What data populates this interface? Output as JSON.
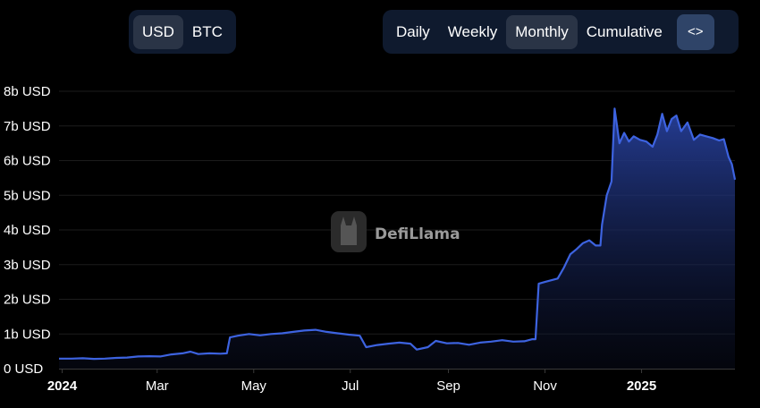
{
  "currency_toggle": {
    "options": [
      "USD",
      "BTC"
    ],
    "selected": "USD"
  },
  "period_toggle": {
    "options": [
      "Daily",
      "Weekly",
      "Monthly",
      "Cumulative"
    ],
    "selected": "Monthly"
  },
  "embed_button": {
    "icon": "code-brackets-icon",
    "glyph": "<>"
  },
  "watermark": {
    "text": "DefiLlama"
  },
  "colors": {
    "line": "#3d63e0",
    "fill_top": "#27409c",
    "background": "#000000",
    "grid": "#1c1c1c",
    "button_bg": "#0f1a2e",
    "active_bg": "#2a3446",
    "embed_bg": "#2f4468"
  },
  "chart_data": {
    "type": "area",
    "title": "",
    "xlabel": "",
    "ylabel": "",
    "ylim": [
      0,
      8
    ],
    "y_unit": "b USD",
    "y_ticks": [
      "0 USD",
      "1b USD",
      "2b USD",
      "3b USD",
      "4b USD",
      "5b USD",
      "6b USD",
      "7b USD",
      "8b USD"
    ],
    "x_ticks": [
      {
        "label": "2024",
        "date": "2024-01-01",
        "bold": true
      },
      {
        "label": "Mar",
        "date": "2024-03-01",
        "bold": false
      },
      {
        "label": "May",
        "date": "2024-05-01",
        "bold": false
      },
      {
        "label": "Jul",
        "date": "2024-07-01",
        "bold": false
      },
      {
        "label": "Sep",
        "date": "2024-09-01",
        "bold": false
      },
      {
        "label": "Nov",
        "date": "2024-11-01",
        "bold": false
      },
      {
        "label": "2025",
        "date": "2025-01-01",
        "bold": true
      }
    ],
    "x_range": [
      "2023-12-30",
      "2025-03-01"
    ],
    "grid": true,
    "series": [
      {
        "values": [
          [
            "2023-12-30",
            0.29
          ],
          [
            "2024-01-07",
            0.29
          ],
          [
            "2024-01-14",
            0.3
          ],
          [
            "2024-01-21",
            0.28
          ],
          [
            "2024-01-28",
            0.29
          ],
          [
            "2024-02-04",
            0.31
          ],
          [
            "2024-02-11",
            0.32
          ],
          [
            "2024-02-18",
            0.35
          ],
          [
            "2024-02-25",
            0.36
          ],
          [
            "2024-03-03",
            0.35
          ],
          [
            "2024-03-10",
            0.41
          ],
          [
            "2024-03-17",
            0.44
          ],
          [
            "2024-03-22",
            0.49
          ],
          [
            "2024-03-27",
            0.42
          ],
          [
            "2024-04-03",
            0.44
          ],
          [
            "2024-04-10",
            0.43
          ],
          [
            "2024-04-14",
            0.44
          ],
          [
            "2024-04-16",
            0.9
          ],
          [
            "2024-04-21",
            0.95
          ],
          [
            "2024-04-28",
            1.0
          ],
          [
            "2024-05-05",
            0.96
          ],
          [
            "2024-05-12",
            1.0
          ],
          [
            "2024-05-19",
            1.02
          ],
          [
            "2024-05-26",
            1.06
          ],
          [
            "2024-06-02",
            1.1
          ],
          [
            "2024-06-09",
            1.12
          ],
          [
            "2024-06-16",
            1.06
          ],
          [
            "2024-06-23",
            1.02
          ],
          [
            "2024-06-30",
            0.98
          ],
          [
            "2024-07-07",
            0.95
          ],
          [
            "2024-07-11",
            0.62
          ],
          [
            "2024-07-18",
            0.68
          ],
          [
            "2024-07-25",
            0.72
          ],
          [
            "2024-08-01",
            0.75
          ],
          [
            "2024-08-08",
            0.72
          ],
          [
            "2024-08-12",
            0.55
          ],
          [
            "2024-08-19",
            0.62
          ],
          [
            "2024-08-24",
            0.8
          ],
          [
            "2024-08-31",
            0.73
          ],
          [
            "2024-09-07",
            0.74
          ],
          [
            "2024-09-14",
            0.69
          ],
          [
            "2024-09-21",
            0.75
          ],
          [
            "2024-09-28",
            0.78
          ],
          [
            "2024-10-05",
            0.82
          ],
          [
            "2024-10-12",
            0.78
          ],
          [
            "2024-10-19",
            0.79
          ],
          [
            "2024-10-24",
            0.85
          ],
          [
            "2024-10-26",
            0.85
          ],
          [
            "2024-10-28",
            2.45
          ],
          [
            "2024-11-01",
            2.5
          ],
          [
            "2024-11-05",
            2.55
          ],
          [
            "2024-11-09",
            2.6
          ],
          [
            "2024-11-13",
            2.92
          ],
          [
            "2024-11-17",
            3.3
          ],
          [
            "2024-11-21",
            3.45
          ],
          [
            "2024-11-25",
            3.62
          ],
          [
            "2024-11-29",
            3.7
          ],
          [
            "2024-12-03",
            3.55
          ],
          [
            "2024-12-06",
            3.55
          ],
          [
            "2024-12-07",
            4.15
          ],
          [
            "2024-12-10",
            5.0
          ],
          [
            "2024-12-13",
            5.4
          ],
          [
            "2024-12-15",
            7.5
          ],
          [
            "2024-12-18",
            6.5
          ],
          [
            "2024-12-21",
            6.8
          ],
          [
            "2024-12-24",
            6.55
          ],
          [
            "2024-12-27",
            6.7
          ],
          [
            "2024-12-31",
            6.6
          ],
          [
            "2025-01-04",
            6.55
          ],
          [
            "2025-01-08",
            6.4
          ],
          [
            "2025-01-11",
            6.75
          ],
          [
            "2025-01-14",
            7.35
          ],
          [
            "2025-01-17",
            6.85
          ],
          [
            "2025-01-20",
            7.2
          ],
          [
            "2025-01-23",
            7.3
          ],
          [
            "2025-01-26",
            6.85
          ],
          [
            "2025-01-30",
            7.1
          ],
          [
            "2025-02-03",
            6.6
          ],
          [
            "2025-02-07",
            6.75
          ],
          [
            "2025-02-11",
            6.7
          ],
          [
            "2025-02-15",
            6.65
          ],
          [
            "2025-02-19",
            6.58
          ],
          [
            "2025-02-22",
            6.62
          ],
          [
            "2025-02-25",
            6.1
          ],
          [
            "2025-02-27",
            5.9
          ],
          [
            "2025-03-01",
            5.45
          ]
        ]
      }
    ]
  }
}
